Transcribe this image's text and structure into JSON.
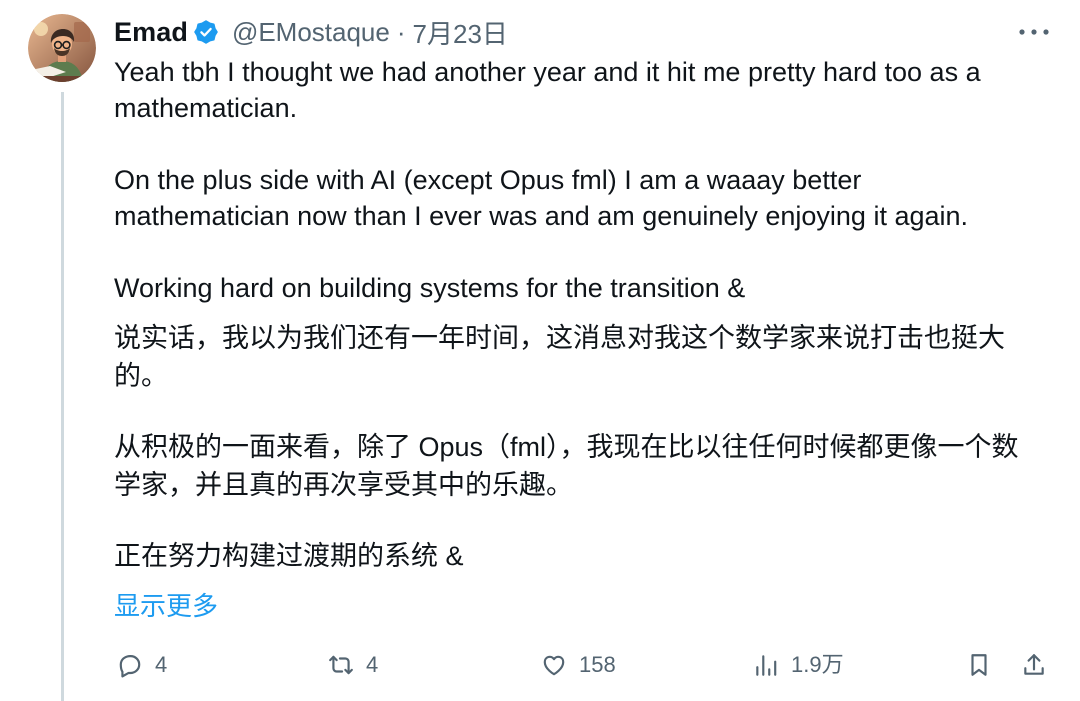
{
  "colors": {
    "text": "#0f1419",
    "muted": "#536471",
    "accent": "#1d9bf0",
    "thread_line": "#cfd9de",
    "verified_badge": "#1d9bf0"
  },
  "tweet": {
    "author": {
      "name": "Emad",
      "verified": true,
      "verified_icon": "verified-badge-icon",
      "handle": "@EMostaque",
      "separator": "·",
      "date": "7月23日"
    },
    "more_icon": "more-icon",
    "original": [
      [
        "Yeah tbh I thought we had another year and it hit me pretty hard too as a",
        "mathematician."
      ],
      [
        "On the plus side with AI (except Opus fml) I am a waaay better",
        "mathematician now than I ever was and am genuinely enjoying it again."
      ],
      [
        "Working hard on building systems for the transition &"
      ]
    ],
    "translation": [
      [
        "说实话，我以为我们还有一年时间，这消息对我这个数学家来说打击也挺大",
        "的。"
      ],
      [
        "从积极的一面来看，除了 Opus（fml），我现在比以往任何时候都更像一个数",
        "学家，并且真的再次享受其中的乐趣。"
      ],
      [
        "正在努力构建过渡期的系统 &"
      ]
    ],
    "show_more": "显示更多",
    "actions": [
      {
        "icon": "reply-icon",
        "count": "4"
      },
      {
        "icon": "retweet-icon",
        "count": "4"
      },
      {
        "icon": "heart-icon",
        "count": "158"
      },
      {
        "icon": "views-icon",
        "count": "1.9万"
      },
      {
        "icon": "bookmark-icon"
      },
      {
        "icon": "share-icon"
      }
    ]
  }
}
